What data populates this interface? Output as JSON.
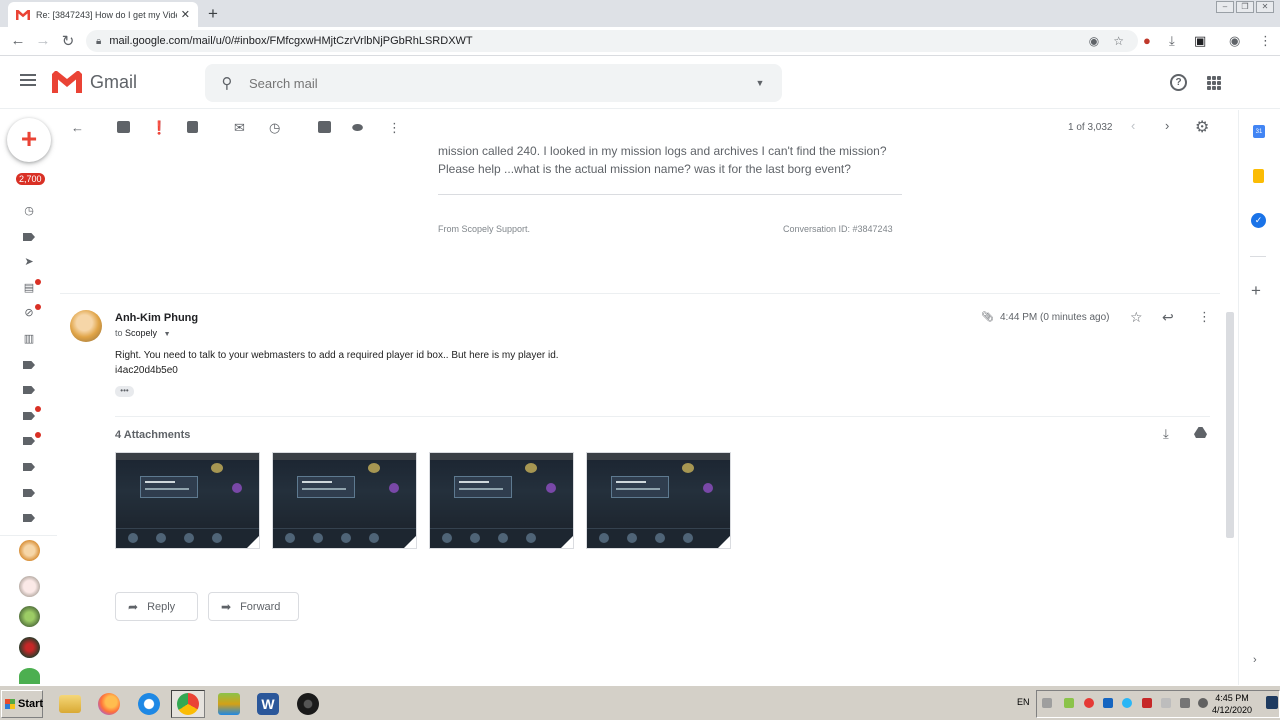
{
  "browser": {
    "tab_title": "Re: [3847243] How do I get my Vide",
    "tab_close": "✕",
    "new_tab": "+",
    "url": "mail.google.com/mail/u/0/#inbox/FMfcgxwHMjtCzrVrlbNjPGbRhLSRDXWT"
  },
  "gmail": {
    "brand": "Gmail",
    "search_placeholder": "Search mail",
    "help": "?",
    "unread_badge": "2,700",
    "compose": "+"
  },
  "toolbar": {
    "pager": "1 of 3,032"
  },
  "thread": {
    "prev_text_1": "mission called 240. I looked in my mission logs and archives I can't find the mission?",
    "prev_text_2": "Please help ...what is the actual mission name? was it for the last borg event?",
    "from_support": "From Scopely Support.",
    "conversation_id": "Conversation ID: #3847243"
  },
  "message": {
    "sender": "Anh-Kim Phung",
    "to_prefix": "to",
    "to_name": "Scopely",
    "time": "4:44 PM (0 minutes ago)",
    "body_1": "Right.  You need to talk to your webmasters to add a required player id box.. But here is my player id.",
    "body_2": "i4ac20d4b5e0",
    "ellipsis": "•••"
  },
  "attachments": {
    "title": "4 Attachments",
    "items": [
      "screenshot-1",
      "screenshot-2",
      "screenshot-3",
      "screenshot-4"
    ]
  },
  "actions": {
    "reply": "Reply",
    "forward": "Forward"
  },
  "taskbar": {
    "start": "Start",
    "lang": "EN",
    "time": "4:45 PM",
    "date": "4/12/2020"
  },
  "colors": {
    "gmail_red": "#ea4335",
    "badge_red": "#d93025",
    "link_blue": "#1a73e8"
  }
}
